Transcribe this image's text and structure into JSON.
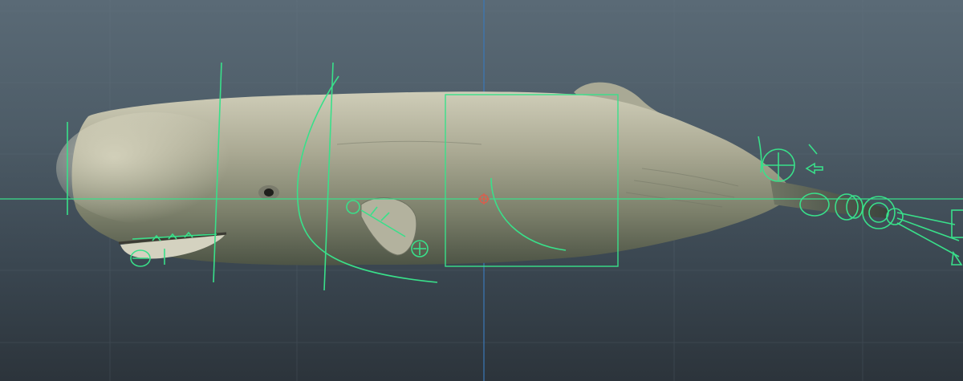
{
  "viewport": {
    "label": "",
    "background_top": "#5a6a76",
    "background_bottom": "#2c343b",
    "grid_color": "#6b7a86",
    "axis_color": "#3a78b8"
  },
  "model": {
    "name": "sperm-whale",
    "skin_light": "#c9c7b2",
    "skin_mid": "#9a9a86",
    "skin_dark": "#4f5547"
  },
  "rig": {
    "control_color": "#39e08a",
    "controls": [
      "head-bound-line",
      "jaw-controls",
      "neck-arc",
      "pectoral-fin-control",
      "body-box-control",
      "center-pivot",
      "dorsal-control",
      "tail-controls",
      "fluke-controls"
    ]
  }
}
